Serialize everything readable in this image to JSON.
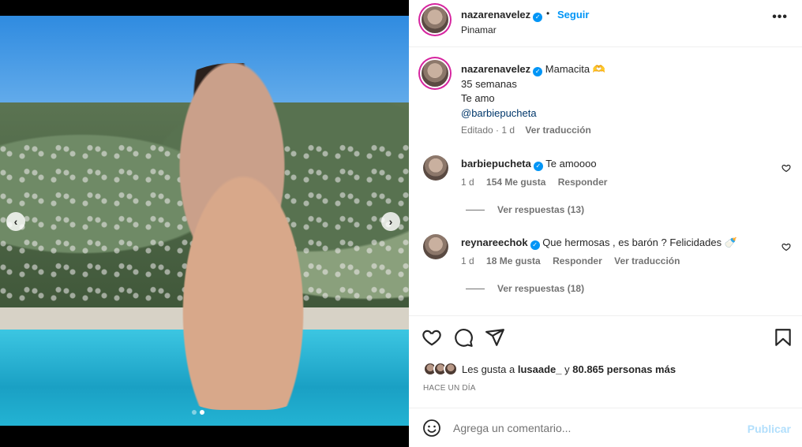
{
  "header": {
    "username": "nazarenavelez",
    "separator": "•",
    "follow_label": "Seguir",
    "location": "Pinamar",
    "more_icon": "more-horizontal-icon"
  },
  "caption": {
    "username": "nazarenavelez",
    "line1": "Mamacita 🫶",
    "line2": "35 semanas",
    "line3": "Te amo",
    "mention": "@barbiepucheta",
    "edited": "Editado",
    "separator": "·",
    "time": "1 d",
    "translate": "Ver traducción"
  },
  "comments": [
    {
      "username": "barbiepucheta",
      "text": "Te amoooo",
      "time": "1 d",
      "likes": "154 Me gusta",
      "reply": "Responder",
      "replies": "Ver respuestas (13)"
    },
    {
      "username": "reynareechok",
      "text": "Que hermosas , es barón ? Felicidades 🍼",
      "time": "1 d",
      "likes": "18 Me gusta",
      "reply": "Responder",
      "translate": "Ver traducción",
      "replies": "Ver respuestas (18)"
    }
  ],
  "likes": {
    "prefix": "Les gusta a",
    "user": "lusaade_",
    "connector": "y",
    "others": "80.865 personas más"
  },
  "posted_ago": "HACE UN DÍA",
  "add_comment": {
    "placeholder": "Agrega un comentario...",
    "publish_label": "Publicar"
  },
  "carousel": {
    "prev": "‹",
    "next": "›",
    "current_index": 2,
    "total": 2
  },
  "colors": {
    "accent": "#0095f6",
    "link": "#00376b",
    "muted": "#737373",
    "publish_disabled": "#b2dffc"
  }
}
